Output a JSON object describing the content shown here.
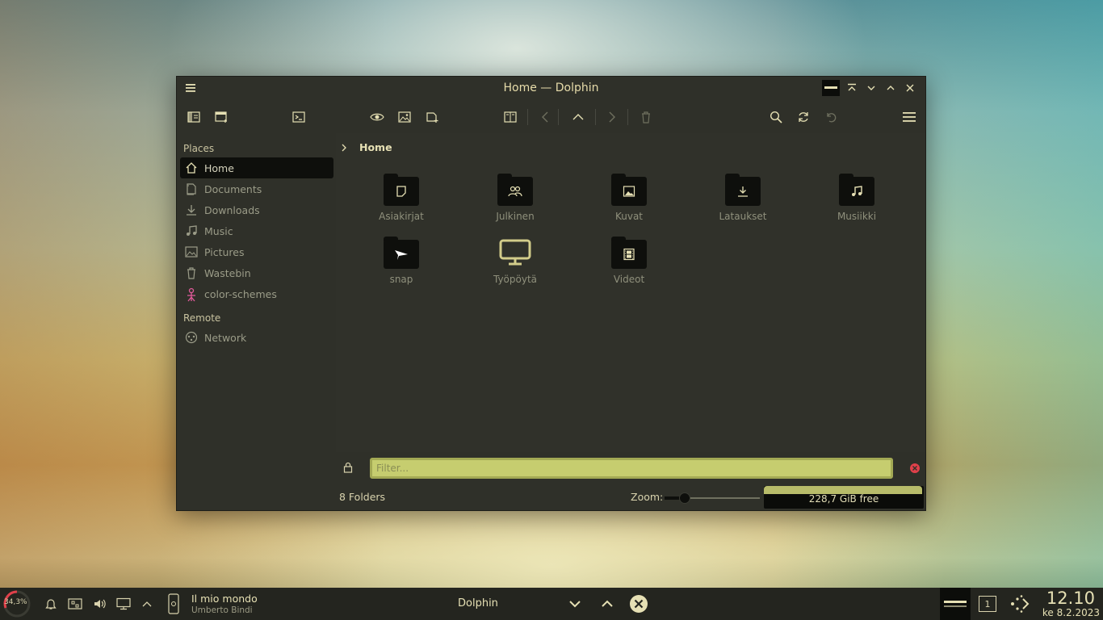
{
  "window": {
    "title": "Home — Dolphin"
  },
  "sidebar": {
    "places_label": "Places",
    "remote_label": "Remote",
    "places": [
      {
        "label": "Home",
        "icon": "home-icon"
      },
      {
        "label": "Documents",
        "icon": "documents-icon"
      },
      {
        "label": "Downloads",
        "icon": "downloads-icon"
      },
      {
        "label": "Music",
        "icon": "music-icon"
      },
      {
        "label": "Pictures",
        "icon": "pictures-icon"
      },
      {
        "label": "Wastebin",
        "icon": "wastebin-icon"
      },
      {
        "label": "color-schemes",
        "icon": "color-schemes-icon"
      }
    ],
    "remote": [
      {
        "label": "Network",
        "icon": "network-icon"
      }
    ]
  },
  "breadcrumb": {
    "current": "Home"
  },
  "folders": [
    {
      "name": "Asiakirjat",
      "icon": "document-icon"
    },
    {
      "name": "Julkinen",
      "icon": "users-icon"
    },
    {
      "name": "Kuvat",
      "icon": "image-icon"
    },
    {
      "name": "Lataukset",
      "icon": "download-icon"
    },
    {
      "name": "Musiikki",
      "icon": "music-note-icon"
    },
    {
      "name": "snap",
      "icon": "snap-bird-icon"
    },
    {
      "name": "Työpöytä",
      "icon": "monitor-icon"
    },
    {
      "name": "Videot",
      "icon": "film-icon"
    }
  ],
  "filter": {
    "placeholder": "Filter..."
  },
  "status": {
    "folder_count": "8 Folders",
    "zoom_label": "Zoom:",
    "zoom_level": 0.2,
    "disk_free": "228,7 GiB free",
    "disk_used_fraction": 0.99
  },
  "panel": {
    "cpu": "34,3%",
    "media_title": "Il mio mondo",
    "media_artist": "Umberto Bindi",
    "task_title": "Dolphin",
    "desktop_number": "1",
    "clock": "12.10",
    "date": "ke 8.2.2023"
  },
  "colors": {
    "accent": "#c6cd6f",
    "text": "#e6e0b4",
    "window_bg": "#2f3029",
    "dark": "#0e0f0c",
    "close_red": "#e0404a"
  }
}
